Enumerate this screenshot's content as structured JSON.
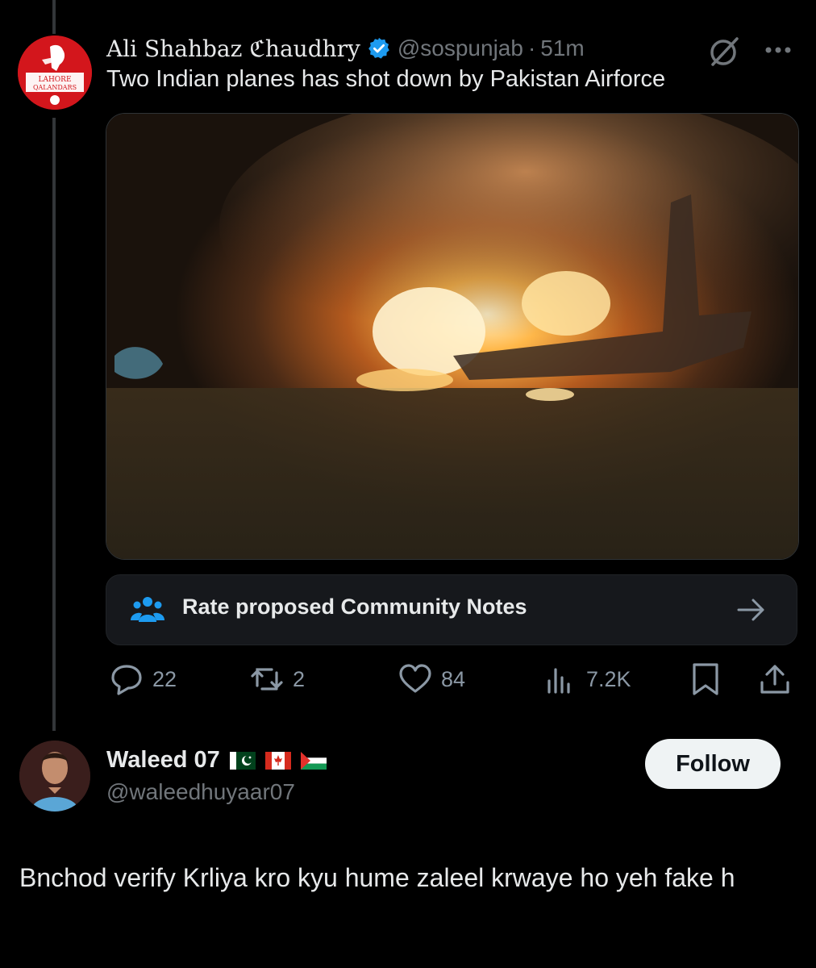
{
  "tweet": {
    "display_name": "Ali Shahbaz ℭhaudhry",
    "handle": "@sospunjab",
    "separator": "·",
    "time": "51m",
    "text": "Two Indian planes has shot down by Pakistan Airforce",
    "avatar_text_line1": "LAHORE",
    "avatar_text_line2": "QALANDARS",
    "community_notes_label": "Rate proposed Community Notes",
    "stats": {
      "replies": "22",
      "reposts": "2",
      "likes": "84",
      "views": "7.2K"
    }
  },
  "reply": {
    "display_name": "Waleed 07",
    "handle": "@waleedhuyaar07",
    "follow_label": "Follow",
    "text": "Bnchod verify Krliya kro kyu hume zaleel krwaye ho yeh fake h",
    "flags": [
      "pakistan-flag",
      "canada-flag",
      "palestine-flag"
    ]
  },
  "colors": {
    "background": "#000000",
    "text_primary": "#e7e9ea",
    "text_secondary": "#71767b",
    "verified_blue": "#1d9bf0",
    "brand_red": "#d3161c"
  }
}
